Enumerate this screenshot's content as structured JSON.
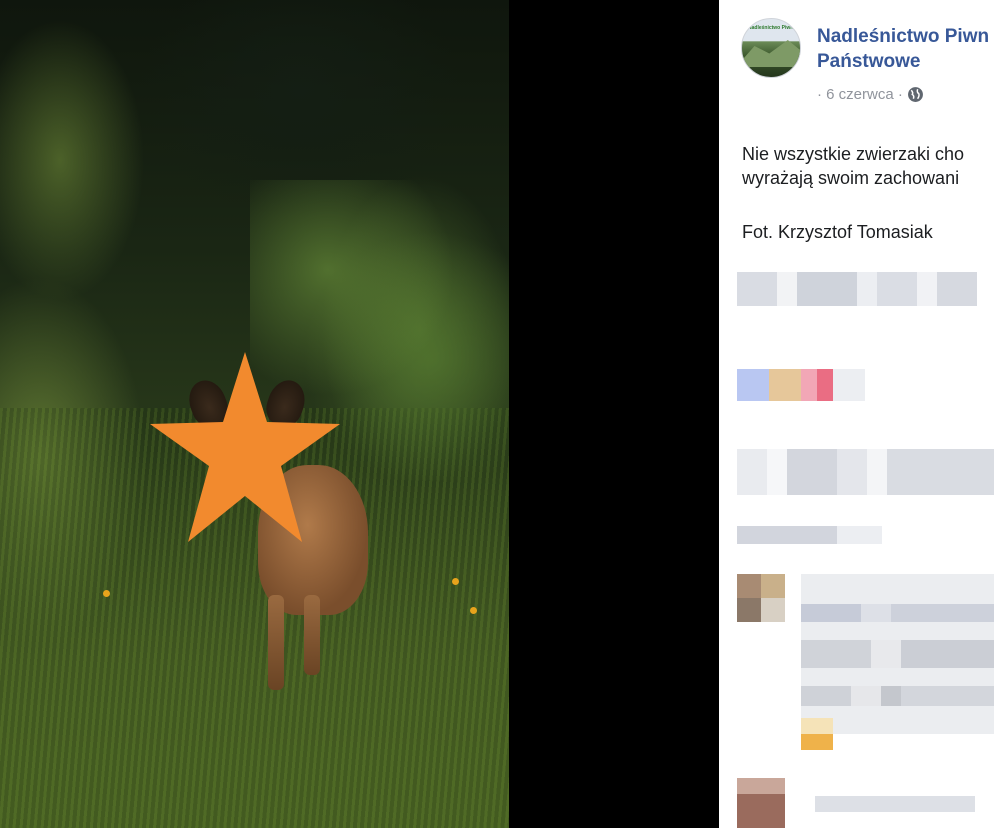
{
  "photo": {
    "subject": "deer-in-meadow",
    "censor_star_color": "#f28a2e"
  },
  "post": {
    "page_name_line1": "Nadleśnictwo Piwn",
    "page_name_line2": "Państwowe",
    "meta_date": "· 6 czerwca ·",
    "privacy_icon": "globe-icon",
    "text_line1": "Nie wszystkie zwierzaki cho",
    "text_line2": "wyrażają swoim zachowani",
    "credit": "Fot. Krzysztof Tomasiak",
    "avatar_caption": "Nadleśnictwo Piwniczna",
    "colors": {
      "link": "#385898",
      "text": "#1c1e21",
      "meta": "#90949c"
    }
  }
}
